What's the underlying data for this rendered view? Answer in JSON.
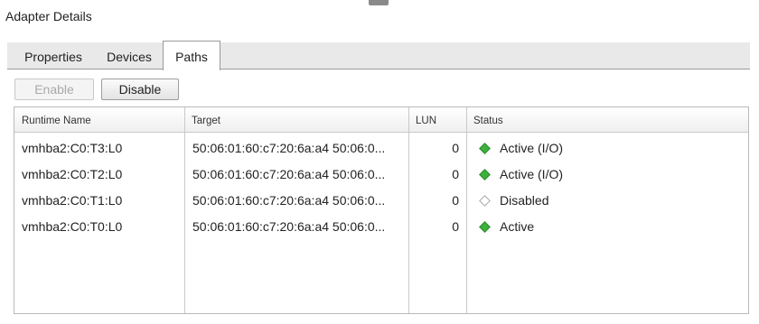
{
  "panel": {
    "title": "Adapter Details"
  },
  "tabs": [
    {
      "label": "Properties",
      "active": false
    },
    {
      "label": "Devices",
      "active": false
    },
    {
      "label": "Paths",
      "active": true
    }
  ],
  "toolbar": {
    "enable_label": "Enable",
    "enable_disabled": true,
    "disable_label": "Disable"
  },
  "grid": {
    "columns": [
      "Runtime Name",
      "Target",
      "LUN",
      "Status"
    ],
    "rows": [
      {
        "runtime_name": "vmhba2:C0:T3:L0",
        "target": "50:06:01:60:c7:20:6a:a4 50:06:0...",
        "lun": "0",
        "status": "Active (I/O)",
        "status_icon": "active-diamond-icon"
      },
      {
        "runtime_name": "vmhba2:C0:T2:L0",
        "target": "50:06:01:60:c7:20:6a:a4 50:06:0...",
        "lun": "0",
        "status": "Active (I/O)",
        "status_icon": "active-diamond-icon"
      },
      {
        "runtime_name": "vmhba2:C0:T1:L0",
        "target": "50:06:01:60:c7:20:6a:a4 50:06:0...",
        "lun": "0",
        "status": "Disabled",
        "status_icon": "disabled-diamond-icon"
      },
      {
        "runtime_name": "vmhba2:C0:T0:L0",
        "target": "50:06:01:60:c7:20:6a:a4 50:06:0...",
        "lun": "0",
        "status": "Active",
        "status_icon": "active-diamond-icon"
      }
    ]
  },
  "colors": {
    "active_status": "#3db13d",
    "disabled_status": "#ffffff",
    "tabstrip_bg": "#e9e9e9"
  }
}
